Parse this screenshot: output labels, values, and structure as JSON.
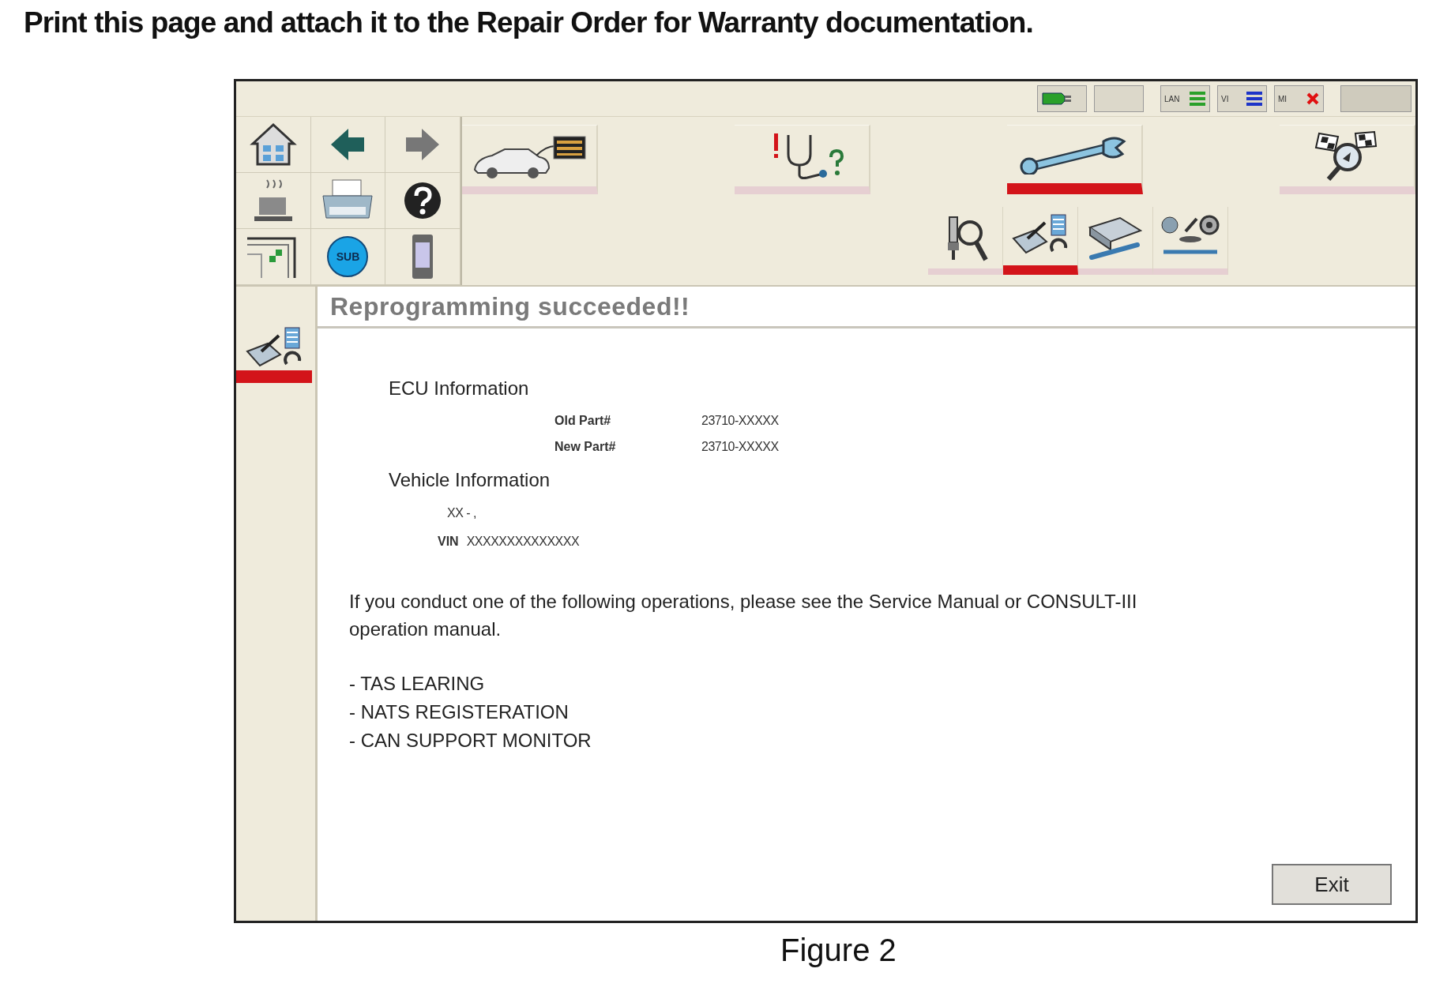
{
  "heading": "Print this page and attach it to the Repair Order for Warranty documentation.",
  "status_bar": [
    {
      "kind": "plug"
    },
    {
      "kind": "blank"
    },
    {
      "kind": "lan",
      "label": "LAN"
    },
    {
      "kind": "vi",
      "label": "VI"
    },
    {
      "kind": "mi",
      "label": "MI"
    },
    {
      "kind": "wide"
    }
  ],
  "quick_buttons": [
    {
      "kind": "home"
    },
    {
      "kind": "back"
    },
    {
      "kind": "forward"
    },
    {
      "kind": "cup"
    },
    {
      "kind": "printer"
    },
    {
      "kind": "help"
    },
    {
      "kind": "frame"
    },
    {
      "kind": "sub",
      "label": "SUB"
    },
    {
      "kind": "device"
    }
  ],
  "main_tabs": [
    {
      "kind": "car",
      "selected": false
    },
    {
      "kind": "stethoscope",
      "selected": false
    },
    {
      "kind": "wrench",
      "selected": true
    },
    {
      "kind": "flags",
      "selected": false
    }
  ],
  "sub_tabs": [
    {
      "kind": "magnifier",
      "selected": false
    },
    {
      "kind": "reprogram",
      "selected": true
    },
    {
      "kind": "ecu",
      "selected": false
    },
    {
      "kind": "parts",
      "selected": false
    }
  ],
  "sidebar": {
    "items": [
      {
        "kind": "reprogram",
        "selected": true
      }
    ]
  },
  "title": "Reprogramming succeeded!!",
  "ecu_information": {
    "heading": "ECU Information",
    "rows": [
      {
        "label": "Old Part#",
        "value": "23710-XXXXX"
      },
      {
        "label": "New Part#",
        "value": "23710-XXXXX"
      }
    ]
  },
  "vehicle_information": {
    "heading": "Vehicle Information",
    "model": "XX - ,",
    "vin_label": "VIN",
    "vin": "XXXXXXXXXXXXXX"
  },
  "notice": "If you conduct one of the following operations, please see the Service Manual or CONSULT-III operation manual.",
  "operations": [
    "- TAS LEARING",
    "- NATS REGISTERATION",
    "- CAN SUPPORT MONITOR"
  ],
  "exit_button": "Exit",
  "caption": "Figure 2"
}
